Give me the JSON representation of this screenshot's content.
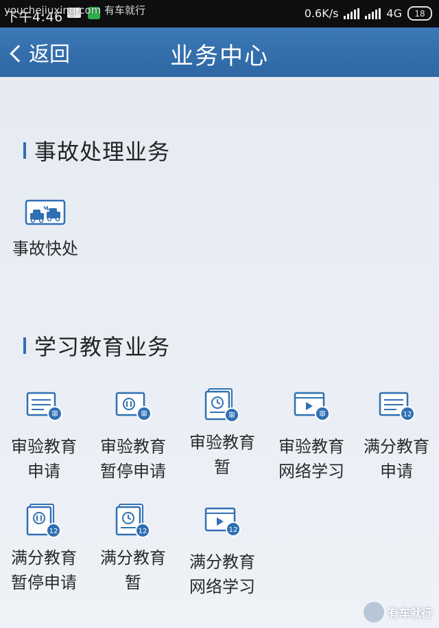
{
  "status_bar": {
    "time": "下午4:46",
    "speed": "0.6K/s",
    "network": "4G",
    "battery": "18",
    "watermark": "youchejiuxing.com 有车就行"
  },
  "nav": {
    "back_label": "返回",
    "title": "业务中心"
  },
  "sections": [
    {
      "title": "事故处理业务",
      "items": [
        {
          "label_line1": "事故快处",
          "label_line2": "",
          "icon": "accident-cars-icon"
        }
      ]
    },
    {
      "title": "学习教育业务",
      "items": [
        {
          "label_line1": "审验教育",
          "label_line2": "申请",
          "icon": "document-badge-icon",
          "badge": "审"
        },
        {
          "label_line1": "审验教育",
          "label_line2": "暂停申请",
          "icon": "pause-doc-badge-icon",
          "badge": "审"
        },
        {
          "label_line1": "审验教育",
          "label_line2": "暂",
          "icon": "clock-doc-badge-icon",
          "badge": "审"
        },
        {
          "label_line1": "审验教育",
          "label_line2": "网络学习",
          "icon": "video-play-badge-icon",
          "badge": "审"
        },
        {
          "label_line1": "满分教育",
          "label_line2": "申请",
          "icon": "document-badge-icon",
          "badge": "12"
        },
        {
          "label_line1": "满分教育",
          "label_line2": "暂停申请",
          "icon": "pause-doc-badge-icon",
          "badge": "12"
        },
        {
          "label_line1": "满分教育",
          "label_line2": "暂",
          "icon": "clock-doc-badge-icon",
          "badge": "12"
        },
        {
          "label_line1": "满分教育",
          "label_line2": "网络学习",
          "icon": "video-play-badge-icon",
          "badge": "12"
        }
      ]
    }
  ],
  "logo_text": "有车就行",
  "colors": {
    "nav": "#3573b0",
    "icon_blue": "#2f6fb3",
    "background": "#e9edf4"
  }
}
